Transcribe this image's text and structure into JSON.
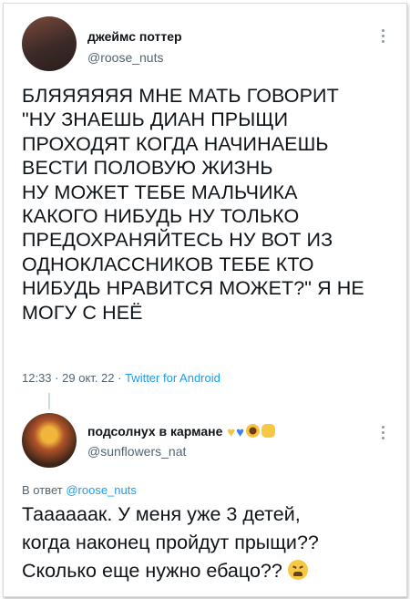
{
  "tweet": {
    "author_name": "джеймс поттер",
    "author_handle": "@roose_nuts",
    "text": "БЛЯЯЯЯЯЯ МНЕ МАТЬ ГОВОРИТ\n\"НУ ЗНАЕШЬ ДИАН ПРЫЩИ\nПРОХОДЯТ КОГДА НАЧИНАЕШЬ\nВЕСТИ ПОЛОВУЮ ЖИЗНЬ\nНУ МОЖЕТ ТЕБЕ МАЛЬЧИКА\nКАКОГО НИБУДЬ НУ ТОЛЬКО\nПРЕДОХРАНЯЙТЕСЬ НУ ВОТ ИЗ\nОДНОКЛАССНИКОВ ТЕБЕ КТО\nНИБУДЬ НРАВИТСЯ МОЖЕТ?\" Я НЕ\nМОГУ С НЕЁ",
    "time": "12:33",
    "date": "29 окт. 22",
    "source": "Twitter for Android",
    "separator": "·"
  },
  "reply": {
    "author_name": "подсолнух в кармане",
    "author_handle": "@sunflowers_nat",
    "replying_prefix": "В ответ",
    "replying_to": "@roose_nuts",
    "text": "Таааааак. У меня уже 3 детей,\nкогда наконец пройдут прыщи??\nСколько еще нужно ебацо??",
    "name_emojis": [
      "yellow-heart",
      "blue-heart",
      "sunflower",
      "raised-fist"
    ]
  },
  "colors": {
    "link": "#1d9bf0",
    "secondary": "#536471",
    "text": "#0f1419"
  }
}
